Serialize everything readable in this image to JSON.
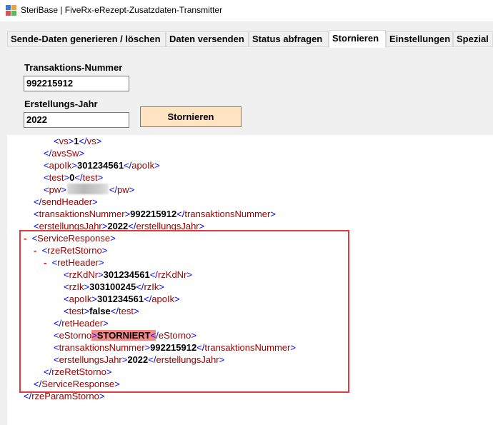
{
  "window": {
    "title": "SteriBase | FiveRx-eRezept-Zusatzdaten-Transmitter",
    "icon": "app-icon"
  },
  "tabs": [
    {
      "label": "Sende-Daten generieren / löschen",
      "active": false
    },
    {
      "label": "Daten versenden",
      "active": false
    },
    {
      "label": "Status abfragen",
      "active": false
    },
    {
      "label": "Stornieren",
      "active": true
    },
    {
      "label": "Einstellungen",
      "active": false
    },
    {
      "label": "Spezial",
      "active": false
    }
  ],
  "form": {
    "transaction_label": "Transaktions-Nummer",
    "transaction_value": "992215912",
    "year_label": "Erstellungs-Jahr",
    "year_value": "2022",
    "cancel_button": "Stornieren"
  },
  "xml": {
    "lines": [
      {
        "open": "vs",
        "value": "1",
        "close": "vs"
      },
      {
        "close_only": "avsSw"
      },
      {
        "open": "apoIk",
        "value": "301234561",
        "close": "apoIk"
      },
      {
        "open": "test",
        "value": "0",
        "close": "test"
      },
      {
        "open": "pw",
        "value": "",
        "close": "pw",
        "masked": true
      },
      {
        "close_only": "sendHeader"
      },
      {
        "open": "transaktionsNummer",
        "value": "992215912",
        "close": "transaktionsNummer"
      },
      {
        "open": "erstellungsJahr",
        "value": "2022",
        "close": "erstellungsJahr"
      },
      {
        "open_only": "ServiceResponse",
        "toggle": "-"
      },
      {
        "open_only": "rzeRetStorno",
        "toggle": "-"
      },
      {
        "open_only": "retHeader",
        "toggle": "-"
      },
      {
        "open": "rzKdNr",
        "value": "301234561",
        "close": "rzKdNr"
      },
      {
        "open": "rzIk",
        "value": "303100245",
        "close": "rzIk"
      },
      {
        "open": "apoIk",
        "value": "301234561",
        "close": "apoIk"
      },
      {
        "open": "test",
        "value": "false",
        "close": "test"
      },
      {
        "close_only": "retHeader"
      },
      {
        "open": "eStorno",
        "value": "STORNIERT",
        "close": "eStorno",
        "highlighted": true
      },
      {
        "open": "transaktionsNummer",
        "value": "992215912",
        "close": "transaktionsNummer"
      },
      {
        "open": "erstellungsJahr",
        "value": "2022",
        "close": "erstellungsJahr"
      },
      {
        "close_only": "rzeRetStorno"
      },
      {
        "close_only": "ServiceResponse"
      },
      {
        "close_only": "rzeParamStorno"
      }
    ]
  },
  "colors": {
    "tag_bracket": "#0000ff",
    "element_name": "#990000",
    "collapse_toggle": "#ff0000",
    "highlight": "#f28a8a",
    "annotation_box": "#e0393e",
    "button_bg": "#ffe4c4"
  }
}
